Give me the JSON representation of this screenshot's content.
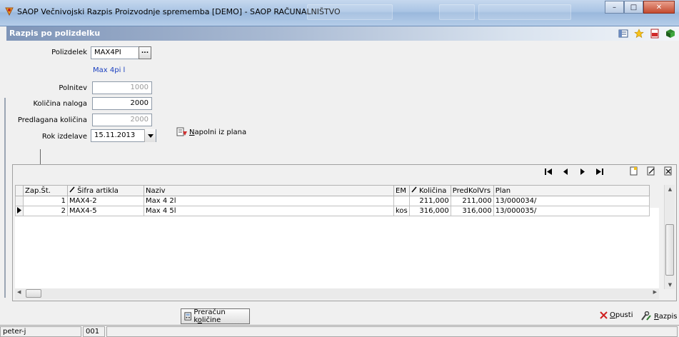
{
  "window": {
    "title": "SAOP  Večnivojski Razpis Proizvodnje sprememba [DEMO] - SAOP RAČUNALNIŠTVO",
    "minimize": "–",
    "maximize": "□",
    "close": "✕"
  },
  "panel": {
    "title": "Razpis po polizdelku"
  },
  "form": {
    "polizdelek_label": "Polizdelek",
    "polizdelek_value": "MAX4PI",
    "polizdelek_dots": "...",
    "polizdelek_name": "Max 4pi  l",
    "polnitev_label": "Polnitev",
    "polnitev_value": "1000",
    "kolicina_naloga_label": "Količina naloga",
    "kolicina_naloga_value": "2000",
    "predlagana_label": "Predlagana količina",
    "predlagana_value": "2000",
    "rok_label": "Rok izdelave",
    "rok_value": "15.11.2013",
    "napolni_first": "N",
    "napolni_rest": "apolni iz plana"
  },
  "grid": {
    "columns": [
      "Zap.Št.",
      "Šifra artikla",
      "Naziv",
      "EM",
      "Količina",
      "PredKolVrs",
      "Plan"
    ],
    "rows": [
      {
        "zap": "1",
        "sifra": "MAX4-2",
        "naziv": "Max 4 2l",
        "em": "",
        "kolicina": "211,000",
        "predkol": "211,000",
        "plan": "13/000034/"
      },
      {
        "zap": "2",
        "sifra": "MAX4-5",
        "naziv": "Max 4 5l",
        "em": "kos",
        "kolicina": "316,000",
        "predkol": "316,000",
        "plan": "13/000035/"
      }
    ]
  },
  "footer": {
    "recalc_pre": "Preračun k",
    "recalc_u": "o",
    "recalc_post": "ličine",
    "opusti_u": "O",
    "opusti_rest": "pusti",
    "razpis_u": "R",
    "razpis_rest": "azpis"
  },
  "status": {
    "user": "peter-j",
    "code": "001"
  }
}
